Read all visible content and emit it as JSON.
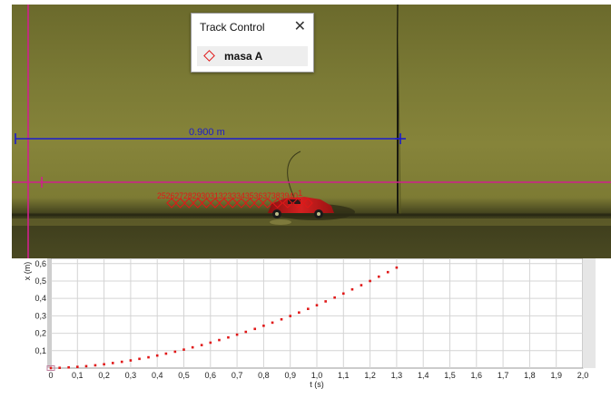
{
  "track_control": {
    "title": "Track Control",
    "close_glyph": "✕",
    "item_label": "masa A",
    "item_icon": "diamond-marker-icon",
    "close_icon": "close-icon",
    "marker_color": "#e01818"
  },
  "video": {
    "measure_label": "0.900 m",
    "measure_color": "#1c1ccc",
    "axes_color": "#d0208c",
    "frame_labels": "25262728293031323334353637383940",
    "frame_labels_tail": "1",
    "frame_count": 16
  },
  "chart_data": {
    "type": "scatter",
    "title": "",
    "xlabel": "t (s)",
    "ylabel": "x (m)",
    "xlim": [
      0,
      2.0
    ],
    "ylim": [
      0,
      0.63
    ],
    "grid": true,
    "x_ticks": [
      "0",
      "0,1",
      "0,2",
      "0,3",
      "0,4",
      "0,5",
      "0,6",
      "0,7",
      "0,8",
      "0,9",
      "1,0",
      "1,1",
      "1,2",
      "1,3",
      "1,4",
      "1,5",
      "1,6",
      "1,7",
      "1,8",
      "1,9",
      "2,0"
    ],
    "y_ticks": [
      "0,1",
      "0,2",
      "0,3",
      "0,4",
      "0,5",
      "0,6"
    ],
    "series": [
      {
        "color": "#e01818",
        "x": [
          0,
          0.033,
          0.067,
          0.1,
          0.133,
          0.167,
          0.2,
          0.233,
          0.267,
          0.3,
          0.333,
          0.367,
          0.4,
          0.433,
          0.467,
          0.5,
          0.533,
          0.567,
          0.6,
          0.633,
          0.667,
          0.7,
          0.733,
          0.767,
          0.8,
          0.833,
          0.867,
          0.9,
          0.933,
          0.967,
          1.0,
          1.033,
          1.067,
          1.1,
          1.133,
          1.167,
          1.2,
          1.233,
          1.267,
          1.3
        ],
        "y": [
          0.0,
          0.0015,
          0.004,
          0.007,
          0.011,
          0.016,
          0.022,
          0.029,
          0.036,
          0.044,
          0.053,
          0.062,
          0.072,
          0.083,
          0.094,
          0.106,
          0.119,
          0.132,
          0.146,
          0.161,
          0.176,
          0.192,
          0.208,
          0.225,
          0.243,
          0.261,
          0.28,
          0.299,
          0.319,
          0.34,
          0.361,
          0.383,
          0.405,
          0.428,
          0.452,
          0.476,
          0.5,
          0.525,
          0.551,
          0.577
        ]
      }
    ]
  }
}
